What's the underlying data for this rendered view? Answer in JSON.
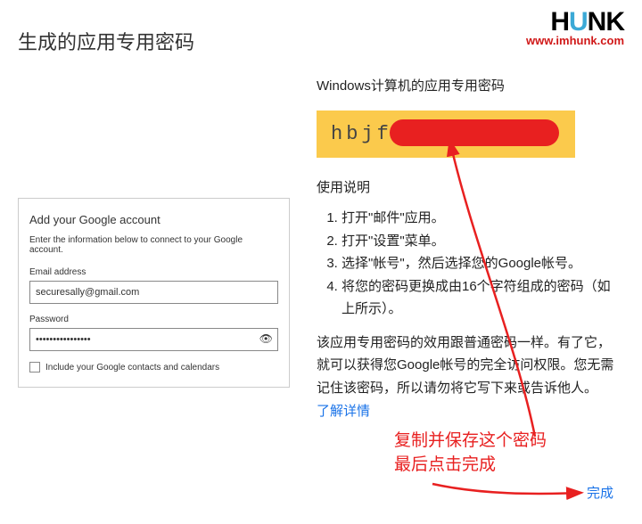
{
  "pageTitle": "生成的应用专用密码",
  "logo": {
    "text": "HUNK",
    "url": "www.imhunk.com"
  },
  "subtitle": "Windows计算机的应用专用密码",
  "passwordVisible": "hbjf",
  "instructionsHead": "使用说明",
  "steps": [
    "打开\"邮件\"应用。",
    "打开\"设置\"菜单。",
    "选择\"帐号\"，然后选择您的Google帐号。",
    "将您的密码更换成由16个字符组成的密码（如上所示）。"
  ],
  "paragraph": "该应用专用密码的效用跟普通密码一样。有了它，就可以获得您Google帐号的完全访问权限。您无需记住该密码，所以请勿将它写下来或告诉他人。",
  "learnMore": "了解详情",
  "annotation": {
    "line1": "复制并保存这个密码",
    "line2": "最后点击完成"
  },
  "doneLabel": "完成",
  "accountCard": {
    "title": "Add your Google account",
    "desc": "Enter the information below to connect to your Google account.",
    "emailLabel": "Email address",
    "emailValue": "securesally@gmail.com",
    "passwordLabel": "Password",
    "passwordValue": "••••••••••••••••",
    "includeLabel": "Include your Google contacts and calendars"
  }
}
